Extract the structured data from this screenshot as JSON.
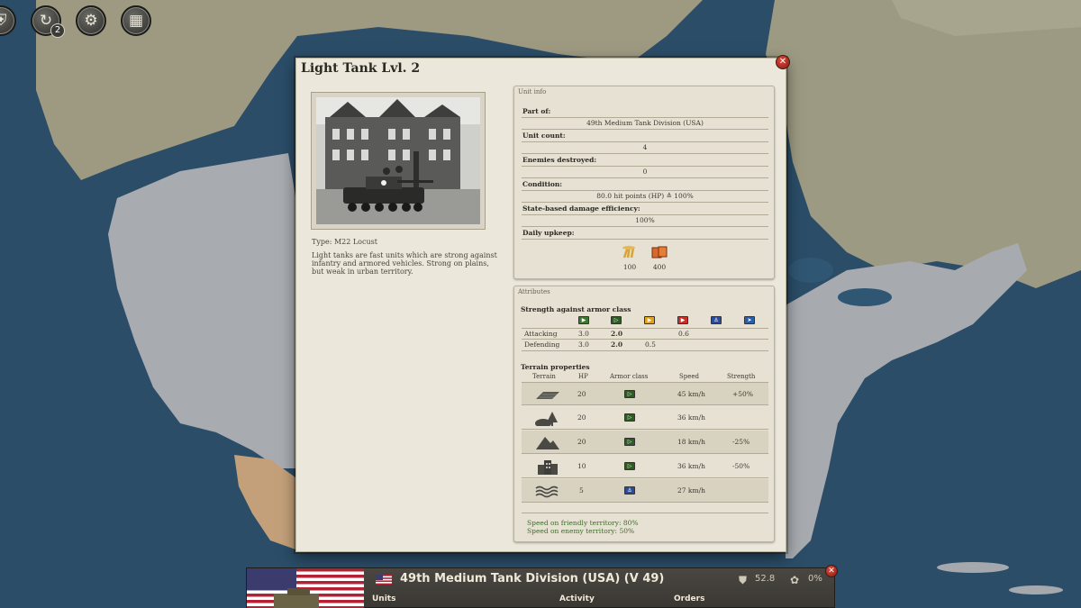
{
  "top_toolbar": {
    "icons": [
      {
        "name": "army-icon",
        "glyph": "⛨"
      },
      {
        "name": "units-icon",
        "glyph": "↻",
        "badge": "2"
      },
      {
        "name": "research-icon",
        "glyph": "⚙"
      },
      {
        "name": "calendar-icon",
        "glyph": "▦"
      }
    ]
  },
  "dialog": {
    "title": "Light Tank Lvl. 2",
    "close_glyph": "✕",
    "unit_type": "Type: M22 Locust",
    "description": "Light tanks are fast units which are strong against infantry and armored vehicles. Strong on plains, but weak in urban territory.",
    "unit_info": {
      "label": "Unit info",
      "rows": [
        {
          "key": "Part of:",
          "value": "49th Medium Tank Division (USA)"
        },
        {
          "key": "Unit count:",
          "value": "4"
        },
        {
          "key": "Enemies destroyed:",
          "value": "0"
        },
        {
          "key": "Condition:",
          "value": "80.0 hit points (HP) ≙ 100%"
        },
        {
          "key": "State-based damage efficiency:",
          "value": "100%"
        }
      ],
      "upkeep_label": "Daily upkeep:",
      "upkeep": [
        {
          "resource": "food",
          "value": "100"
        },
        {
          "resource": "goods",
          "value": "400"
        }
      ]
    },
    "attributes": {
      "label": "Attributes",
      "strength_title": "Strength against armor class",
      "armor_classes": [
        {
          "icon": "infantry-armor-icon",
          "color": "#3b7a2e"
        },
        {
          "icon": "unarmored-armor-icon",
          "color": "#2f5a26"
        },
        {
          "icon": "light-armor-icon",
          "color": "#e0a321"
        },
        {
          "icon": "heavy-armor-icon",
          "color": "#c8302a"
        },
        {
          "icon": "naval-armor-icon",
          "color": "#2a4a9a"
        },
        {
          "icon": "air-armor-icon",
          "color": "#2c5ea8"
        }
      ],
      "strength_rows": [
        {
          "label": "Attacking",
          "values": [
            "3.0",
            "2.0",
            "",
            "0.6",
            "",
            ""
          ]
        },
        {
          "label": "Defending",
          "values": [
            "3.0",
            "2.0",
            "0.5",
            "",
            "",
            ""
          ]
        }
      ],
      "terrain_title": "Terrain properties",
      "terrain_headers": [
        "Terrain",
        "HP",
        "Armor class",
        "Speed",
        "Strength"
      ],
      "terrain_rows": [
        {
          "terrain": "plains",
          "hp": "20",
          "armor": "unarmored-armor-icon",
          "speed": "45 km/h",
          "strength": "+50%"
        },
        {
          "terrain": "forest",
          "hp": "20",
          "armor": "unarmored-armor-icon",
          "speed": "36 km/h",
          "strength": ""
        },
        {
          "terrain": "mountains",
          "hp": "20",
          "armor": "unarmored-armor-icon",
          "speed": "18 km/h",
          "strength": "-25%"
        },
        {
          "terrain": "urban",
          "hp": "10",
          "armor": "unarmored-armor-icon",
          "speed": "36 km/h",
          "strength": "-50%"
        },
        {
          "terrain": "sea",
          "hp": "5",
          "armor": "naval-armor-icon",
          "speed": "27 km/h",
          "strength": ""
        }
      ],
      "speed_friendly": "Speed on friendly territory: 80%",
      "speed_enemy": "Speed on enemy territory: 50%"
    }
  },
  "division_bar": {
    "title": "49th Medium Tank Division (USA) (V 49)",
    "strength_value": "52.8",
    "morale_value": "0%",
    "tabs": [
      "Units",
      "Activity",
      "Orders"
    ]
  }
}
